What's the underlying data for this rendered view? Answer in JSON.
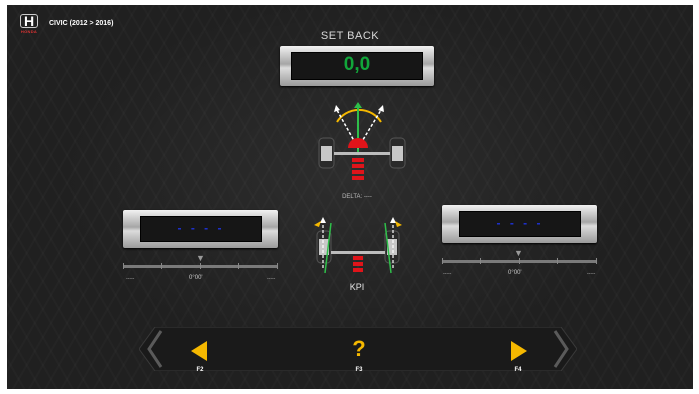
{
  "header": {
    "brand_letter": "H",
    "brand_name": "HONDA",
    "vehicle": "CIVIC (2012 > 2016)"
  },
  "setback": {
    "title": "SET BACK",
    "value": "0,0"
  },
  "delta": {
    "label": "DELTA:",
    "value": "----"
  },
  "left_wheel": {
    "value": "- - - -",
    "angle": "0°00'",
    "left_dash": "-----",
    "right_dash": "-----"
  },
  "right_wheel": {
    "value": "- - - -",
    "angle": "0°00'",
    "left_dash": "-----",
    "right_dash": "-----"
  },
  "kpi": {
    "label": "KPI"
  },
  "footer": {
    "keys": [
      {
        "key": "F2",
        "icon": "prev-arrow-icon"
      },
      {
        "key": "F3",
        "icon": "help-question-icon",
        "glyph": "?"
      },
      {
        "key": "F4",
        "icon": "next-arrow-icon"
      }
    ]
  },
  "colors": {
    "background": "#202020",
    "value_green": "#11a63a",
    "dash_blue": "#1e32d6",
    "accent_yellow": "#f5b800",
    "wheel_red": "#e0141a"
  }
}
